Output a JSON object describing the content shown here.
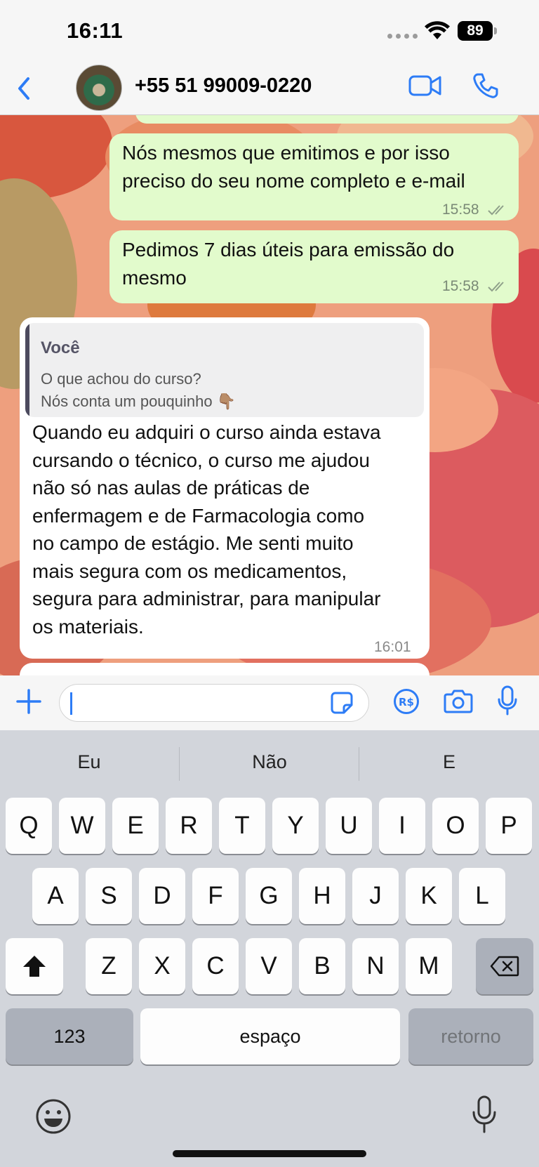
{
  "status_bar": {
    "time": "16:11",
    "battery": "89"
  },
  "header": {
    "contact": "+55 51 99009-0220"
  },
  "messages": [
    {
      "direction": "outgoing",
      "lines": [
        "Nós mesmos que emitimos e por isso",
        "preciso do seu nome completo e e-mail"
      ],
      "time": "15:58",
      "read": true
    },
    {
      "direction": "outgoing",
      "lines": [
        "Pedimos 7 dias úteis para emissão do",
        "mesmo"
      ],
      "time": "15:58",
      "read": true
    },
    {
      "direction": "incoming",
      "quote": {
        "author": "Você",
        "line1": "O que achou do curso?",
        "line2": "Nós conta um pouquinho 👇🏽"
      },
      "lines": [
        "Quando eu adquiri o curso ainda estava",
        "cursando o técnico, o curso me ajudou",
        "não só nas aulas de práticas de",
        "enfermagem e de Farmacologia como",
        "no campo de estágio. Me senti muito",
        "mais segura com os medicamentos,",
        "segura para administrar, para manipular",
        "os materiais."
      ],
      "time": "16:01"
    }
  ],
  "input": {
    "placeholder": ""
  },
  "keyboard": {
    "predictions": [
      "Eu",
      "Não",
      "E"
    ],
    "row1": [
      "Q",
      "W",
      "E",
      "R",
      "T",
      "Y",
      "U",
      "I",
      "O",
      "P"
    ],
    "row2": [
      "A",
      "S",
      "D",
      "F",
      "G",
      "H",
      "J",
      "K",
      "L"
    ],
    "row3": [
      "Z",
      "X",
      "C",
      "V",
      "B",
      "N",
      "M"
    ],
    "numbers_key": "123",
    "space_key": "espaço",
    "return_key": "retorno"
  },
  "colors": {
    "accent": "#2d7cf6",
    "outgoing_bubble": "#e2fbcc",
    "incoming_bubble": "#ffffff"
  },
  "icons": [
    "back-icon",
    "video-call-icon",
    "phone-call-icon",
    "plus-icon",
    "sticker-icon",
    "pix-icon",
    "camera-icon",
    "microphone-icon",
    "shift-icon",
    "delete-icon",
    "emoji-icon",
    "dictation-icon"
  ]
}
